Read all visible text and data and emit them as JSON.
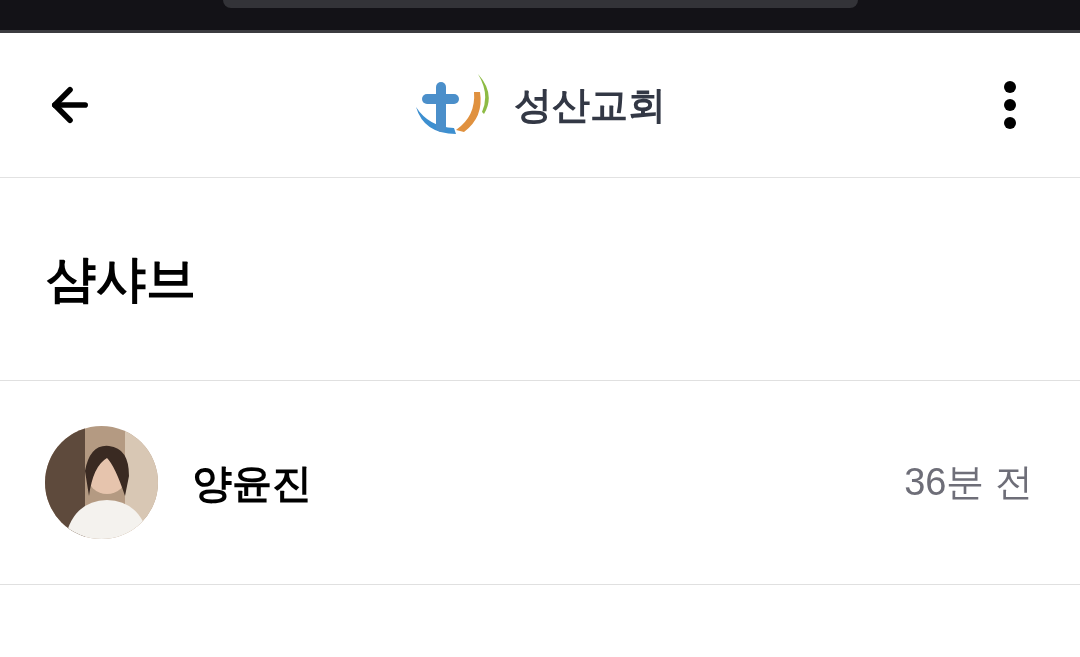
{
  "header": {
    "title": "성산교회"
  },
  "post": {
    "title": "샴샤브",
    "author": "양윤진",
    "time": "36분 전"
  }
}
